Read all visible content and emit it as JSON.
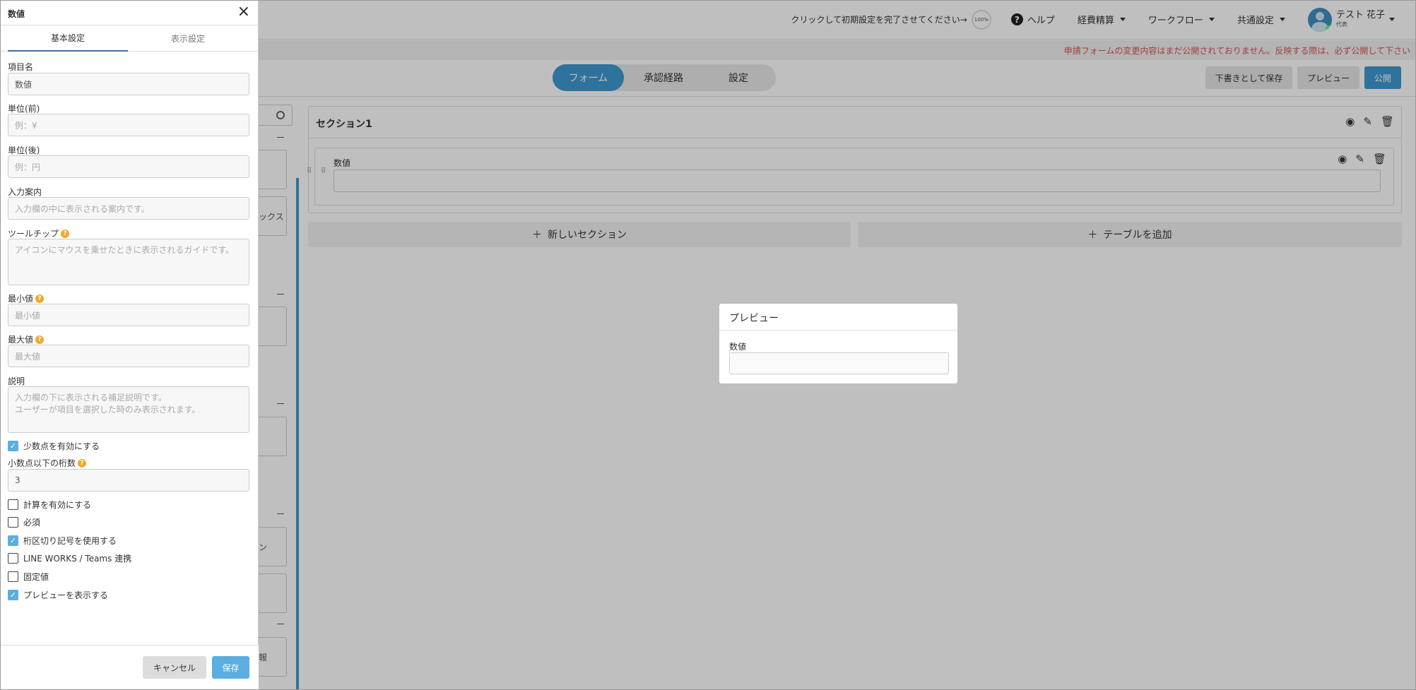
{
  "topbar": {
    "setup_prompt": "クリックして初期設定を完了させてください→",
    "setup_percent": "100%",
    "help": "ヘルプ",
    "menu_expense": "経費精算",
    "menu_workflow": "ワークフロー",
    "menu_common": "共通設定",
    "user_name": "テスト 花子",
    "user_role": "代表"
  },
  "notice": "申請フォームの変更内容はまだ公開されておりません。反映する際は、必ず公開して下さい",
  "subbar": {
    "tabs": [
      "フォーム",
      "承認経路",
      "設定"
    ],
    "save_draft": "下書きとして保存",
    "preview": "プレビュー",
    "publish": "公開"
  },
  "palette": {
    "item_partial_1": "ックス",
    "item_partial_2": "ン",
    "item_partial_3": "報"
  },
  "canvas": {
    "section_title": "セクション1",
    "field_label": "数値",
    "add_section": "新しいセクション",
    "add_table": "テーブルを追加"
  },
  "preview_modal": {
    "title": "プレビュー",
    "field_label": "数値"
  },
  "panel": {
    "title": "数値",
    "tabs": [
      "基本設定",
      "表示設定"
    ],
    "fields": {
      "item_name_label": "項目名",
      "item_name_value": "数値",
      "unit_before_label": "単位(前)",
      "unit_before_placeholder": "例：¥",
      "unit_after_label": "単位(後)",
      "unit_after_placeholder": "例：円",
      "input_guide_label": "入力案内",
      "input_guide_placeholder": "入力欄の中に表示される案内です。",
      "tooltip_label": "ツールチップ",
      "tooltip_placeholder": "アイコンにマウスを乗せたときに表示されるガイドです。",
      "min_label": "最小値",
      "min_placeholder": "最小値",
      "max_label": "最大値",
      "max_placeholder": "最大値",
      "description_label": "説明",
      "description_placeholder": "入力欄の下に表示される補足説明です。\nユーザーが項目を選択した時のみ表示されます。",
      "decimal_digits_label": "小数点以下の桁数",
      "decimal_digits_value": "3"
    },
    "checkboxes": {
      "enable_decimal": {
        "label": "少数点を有効にする",
        "checked": true
      },
      "enable_calc": {
        "label": "計算を有効にする",
        "checked": false
      },
      "required": {
        "label": "必須",
        "checked": false
      },
      "thousands_sep": {
        "label": "桁区切り記号を使用する",
        "checked": true
      },
      "lineworks": {
        "label": "LINE WORKS / Teams 連携",
        "checked": false
      },
      "fixed_value": {
        "label": "固定値",
        "checked": false
      },
      "show_preview": {
        "label": "プレビューを表示する",
        "checked": true
      }
    },
    "cancel": "キャンセル",
    "save": "保存"
  },
  "colors": {
    "accent": "#3d9ad1",
    "checkbox_on": "#5aaee0",
    "notice_text": "#d9534f",
    "help_badge": "#f0a92a"
  }
}
